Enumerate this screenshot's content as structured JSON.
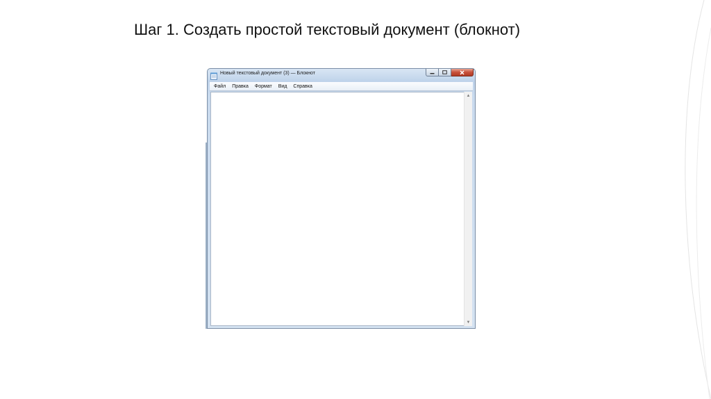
{
  "slide": {
    "title": "Шаг 1. Создать простой текстовый документ (блокнот)"
  },
  "window": {
    "title": "Новый текстовый документ (3) — Блокнот",
    "app_icon": "notepad-icon",
    "controls": {
      "minimize_icon": "minimize-icon",
      "maximize_icon": "maximize-icon",
      "close_icon": "close-icon"
    }
  },
  "menu": {
    "items": [
      {
        "label": "Файл"
      },
      {
        "label": "Правка"
      },
      {
        "label": "Формат"
      },
      {
        "label": "Вид"
      },
      {
        "label": "Справка"
      }
    ]
  },
  "editor": {
    "content": ""
  },
  "colors": {
    "close_button": "#c7503a",
    "frame": "#c9daee"
  }
}
